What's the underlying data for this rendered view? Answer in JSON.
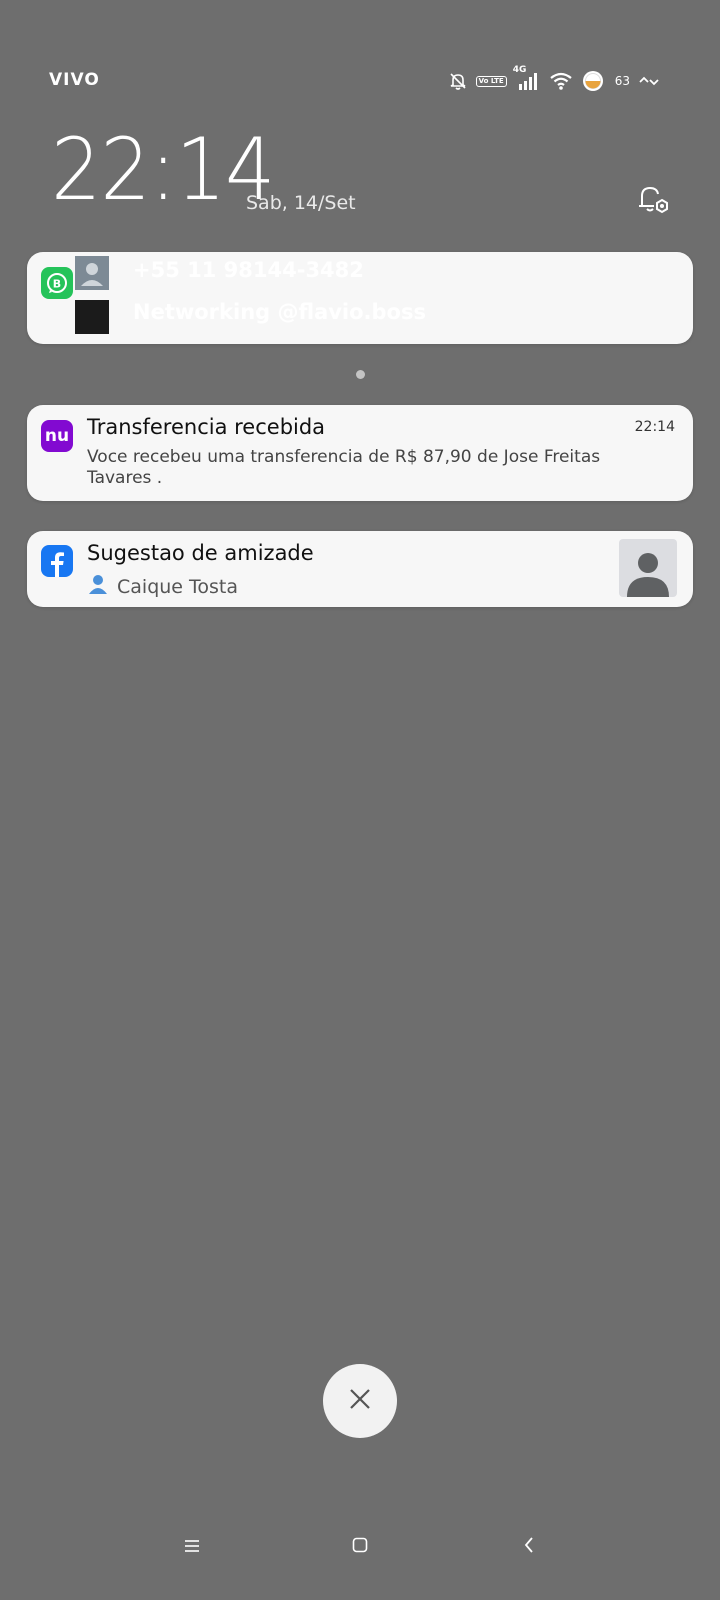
{
  "status_bar": {
    "carrier": "VIVO",
    "network": "4G",
    "volte": "Vo LTE",
    "battery": "63"
  },
  "lockscreen": {
    "time": "22:14",
    "date": "Sab, 14/Set"
  },
  "notifications": {
    "whatsapp": {
      "rows": [
        {
          "title": "+55 11 98144-3482",
          "message": ""
        },
        {
          "title": "Networking @flavio.boss",
          "message": ""
        }
      ]
    },
    "nubank": {
      "icon_text": "nu",
      "title": "Transferencia recebida",
      "time": "22:14",
      "body": "Voce recebeu uma transferencia de R$ 87,90 de Jose Freitas Tavares ."
    },
    "facebook": {
      "title": "Sugestao de amizade",
      "subtitle": "Caique Tosta"
    }
  },
  "colors": {
    "background": "#6e6e6e",
    "whatsapp_green": "#25c35a",
    "nubank_purple": "#820ad1",
    "facebook_blue": "#1877f2"
  }
}
